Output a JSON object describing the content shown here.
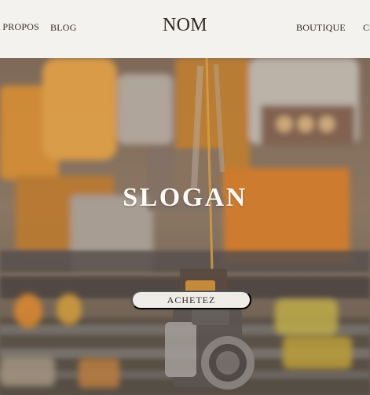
{
  "header": {
    "brand": "NOM",
    "nav_left": [
      {
        "label": "A PROPOS"
      },
      {
        "label": "BLOG"
      }
    ],
    "nav_right": [
      {
        "label": "BOUTIQUE"
      },
      {
        "label": "CONTACT"
      }
    ]
  },
  "hero": {
    "slogan": "SLOGAN",
    "cta_label": "ACHETEZ"
  }
}
